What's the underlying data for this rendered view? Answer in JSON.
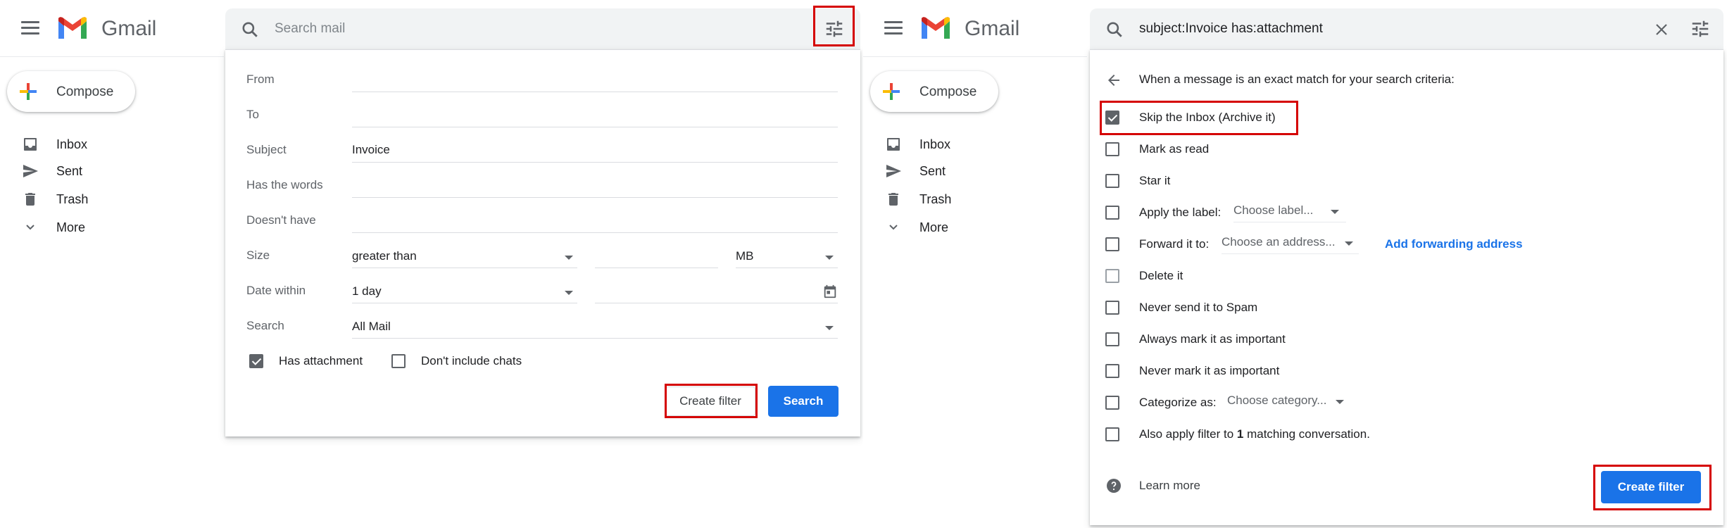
{
  "app": {
    "brand": "Gmail"
  },
  "nav": {
    "compose_label": "Compose",
    "items": [
      {
        "label": "Inbox",
        "icon": "inbox-icon"
      },
      {
        "label": "Sent",
        "icon": "send-icon"
      },
      {
        "label": "Trash",
        "icon": "trash-icon"
      },
      {
        "label": "More",
        "icon": "chevron-down-icon"
      }
    ]
  },
  "left": {
    "search_placeholder": "Search mail",
    "form": {
      "from_label": "From",
      "from_value": "",
      "to_label": "To",
      "to_value": "",
      "subject_label": "Subject",
      "subject_value": "Invoice",
      "haswords_label": "Has the words",
      "haswords_value": "",
      "doesnthave_label": "Doesn't have",
      "doesnthave_value": "",
      "size_label": "Size",
      "size_op": "greater than",
      "size_value": "",
      "size_unit": "MB",
      "date_label": "Date within",
      "date_value": "1 day",
      "date_date": "",
      "search_label": "Search",
      "search_scope": "All Mail",
      "has_attachment_label": "Has attachment",
      "has_attachment_checked": true,
      "no_chats_label": "Don't include chats",
      "no_chats_checked": false
    },
    "create_filter_label": "Create filter",
    "search_button_label": "Search"
  },
  "right": {
    "query": "subject:Invoice has:attachment",
    "heading": "When a message is an exact match for your search criteria:",
    "options": {
      "skip_inbox": "Skip the Inbox (Archive it)",
      "mark_read": "Mark as read",
      "star": "Star it",
      "apply_label": "Apply the label:",
      "apply_label_select": "Choose label...",
      "forward": "Forward it to:",
      "forward_select": "Choose an address...",
      "add_forwarding": "Add forwarding address",
      "delete": "Delete it",
      "never_spam": "Never send it to Spam",
      "always_important": "Always mark it as important",
      "never_important": "Never mark it as important",
      "categorize": "Categorize as:",
      "categorize_select": "Choose category...",
      "also_apply_pre": "Also apply filter to ",
      "also_apply_count": "1",
      "also_apply_post": " matching conversation."
    },
    "checked": {
      "skip_inbox": true
    },
    "learn_more": "Learn more",
    "create_filter_label": "Create filter"
  },
  "colors": {
    "accent": "#1a73e8",
    "highlight": "#d50000"
  }
}
